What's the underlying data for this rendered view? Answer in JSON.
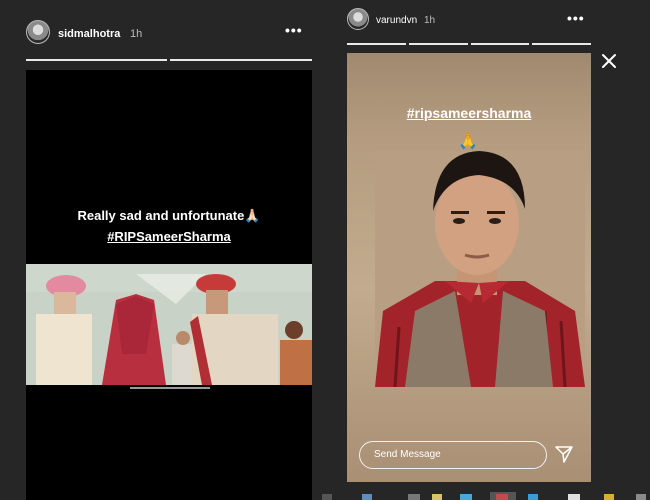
{
  "left_story": {
    "username": "sidmalhotra",
    "time": "1h",
    "more_icon": "more-dots-icon",
    "caption_line1": "Really sad and unfortunate🙏🏻",
    "caption_line2": "#RIPSameerSharma"
  },
  "right_story": {
    "username": "varundvn",
    "time": "1h",
    "more_icon": "more-dots-icon",
    "hashtag": "#ripsameersharma",
    "emoji": "🙏",
    "send_placeholder": "Send Message",
    "send_icon": "paper-plane-icon"
  },
  "close_icon": "close-icon",
  "colors": {
    "background": "#262626",
    "progress": "#e9e9e9",
    "media_black": "#000000",
    "shirt_red": "#a3232b"
  }
}
